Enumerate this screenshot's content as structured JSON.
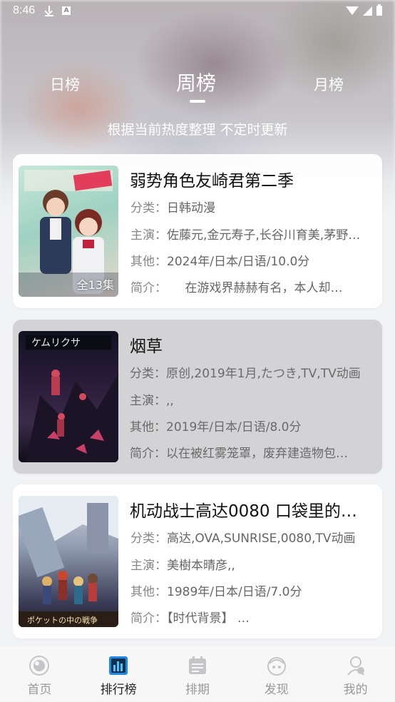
{
  "status_bar": {
    "time": "8:46"
  },
  "tabs": {
    "day": "日榜",
    "week": "周榜",
    "month": "月榜",
    "active": "week"
  },
  "subtitle": "根据当前热度整理 不定时更新",
  "list": [
    {
      "title": "弱势角色友崎君第二季",
      "badge": "全13集",
      "category_label": "分类：",
      "category": "日韩动漫",
      "cast_label": "主演：",
      "cast": "佐藤元,金元寿子,长谷川育美,茅野…",
      "other_label": "其他：",
      "other": "2024年/日本/日语/10.0分",
      "intro_label": "简介：",
      "intro": "　　在游戏界赫赫有名，本人却…"
    },
    {
      "title": "烟草",
      "badge": "",
      "category_label": "分类：",
      "category": "原创,2019年1月,たつき,TV,TV动画",
      "cast_label": "主演：",
      "cast": ",,",
      "other_label": "其他：",
      "other": "2019年/日本/日语/8.0分",
      "intro_label": "简介：",
      "intro": "以在被红雾笼罩，废弃建造物包…"
    },
    {
      "title": "机动战士高达0080 口袋里的…",
      "badge": "",
      "category_label": "分类：",
      "category": "高达,OVA,SUNRISE,0080,TV动画",
      "cast_label": "主演：",
      "cast": "美樹本晴彦,,",
      "other_label": "其他：",
      "other": "1989年/日本/日语/7.0分",
      "intro_label": "简介：",
      "intro": "【时代背景】 …"
    }
  ],
  "bottom_nav": [
    {
      "label": "首页",
      "icon": "home-icon"
    },
    {
      "label": "排行榜",
      "icon": "ranking-icon"
    },
    {
      "label": "排期",
      "icon": "calendar-icon"
    },
    {
      "label": "发现",
      "icon": "discover-icon"
    },
    {
      "label": "我的",
      "icon": "profile-icon"
    }
  ],
  "colors": {
    "active_nav": "#1e88e5",
    "inactive_nav": "#c5c5c8"
  }
}
